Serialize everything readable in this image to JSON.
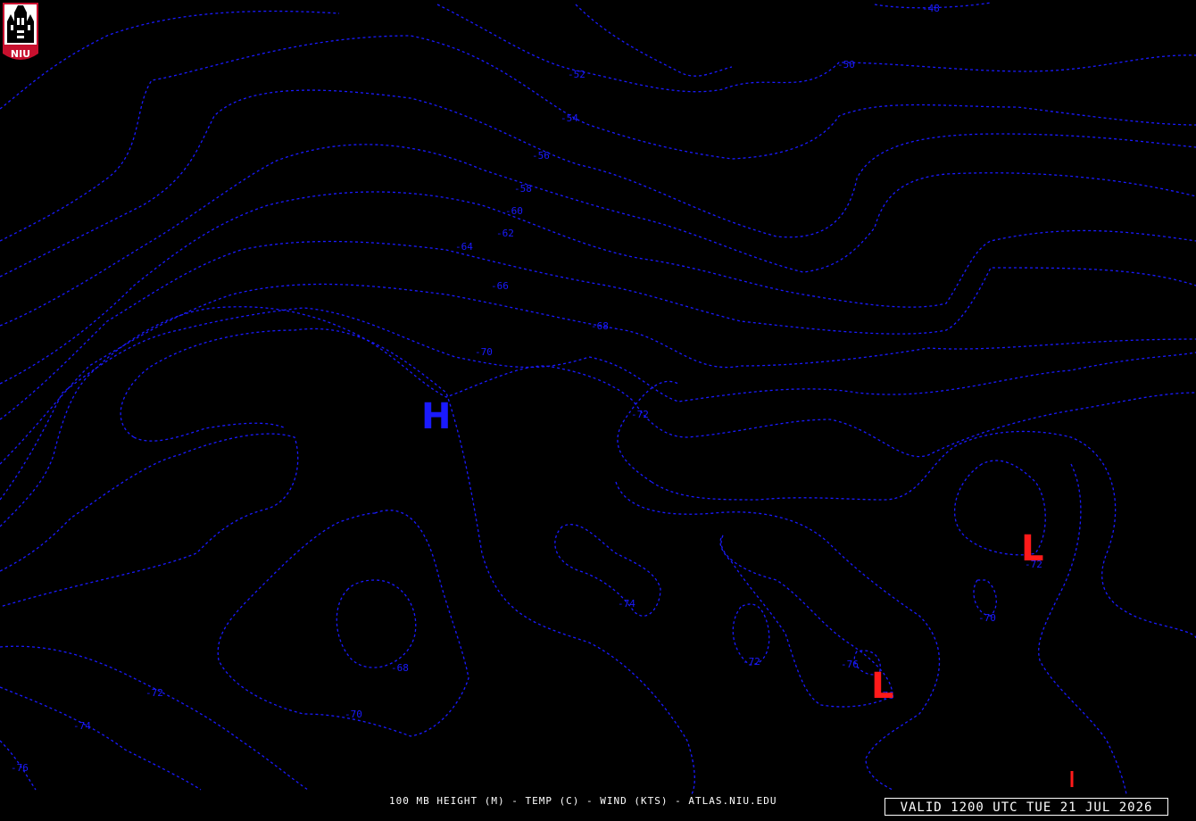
{
  "logo": {
    "text": "NIU"
  },
  "map": {
    "colors": {
      "contour": "#1a1aff",
      "high": "#1a1aff",
      "low": "#ff1a1a",
      "background": "#000000",
      "text": "#ffffff"
    },
    "contour_labels": [
      "-48",
      "-50",
      "-52",
      "-54",
      "-56",
      "-58",
      "-60",
      "-62",
      "-64",
      "-66",
      "-68",
      "-70",
      "-72",
      "-72",
      "-72",
      "-72",
      "-74",
      "-74",
      "-76",
      "-76",
      "-70",
      "-70",
      "-68",
      "-76"
    ],
    "high_symbol": "H",
    "low_symbol": "L",
    "wind_barb_color": "#ff1a1a"
  },
  "footer": {
    "caption": "100 MB HEIGHT (M) - TEMP (C) - WIND (KTS) - ATLAS.NIU.EDU",
    "valid_time": "VALID 1200 UTC TUE 21 JUL 2026"
  }
}
